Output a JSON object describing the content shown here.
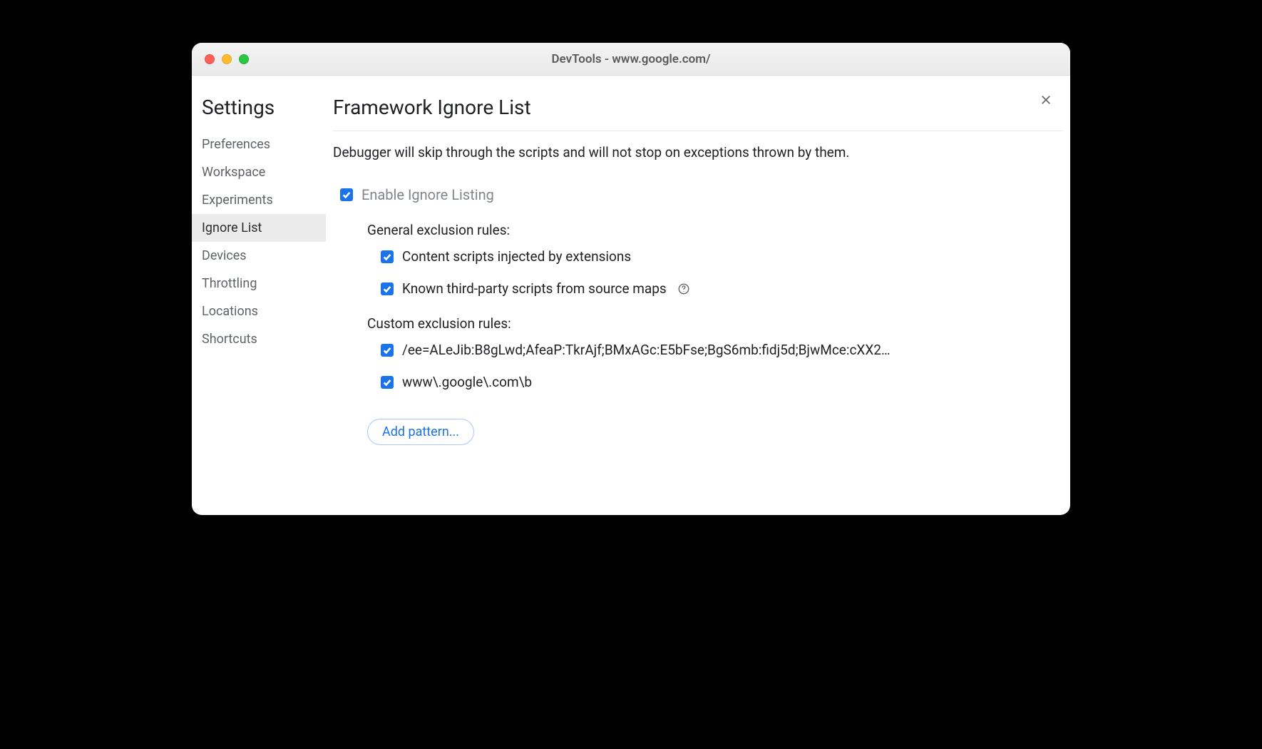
{
  "window": {
    "title": "DevTools - www.google.com/"
  },
  "sidebar": {
    "header": "Settings",
    "items": [
      {
        "label": "Preferences",
        "selected": false
      },
      {
        "label": "Workspace",
        "selected": false
      },
      {
        "label": "Experiments",
        "selected": false
      },
      {
        "label": "Ignore List",
        "selected": true
      },
      {
        "label": "Devices",
        "selected": false
      },
      {
        "label": "Throttling",
        "selected": false
      },
      {
        "label": "Locations",
        "selected": false
      },
      {
        "label": "Shortcuts",
        "selected": false
      }
    ]
  },
  "main": {
    "title": "Framework Ignore List",
    "description": "Debugger will skip through the scripts and will not stop on exceptions thrown by them.",
    "enable_label": "Enable Ignore Listing",
    "general_heading": "General exclusion rules:",
    "general_rules": [
      {
        "label": "Content scripts injected by extensions",
        "checked": true,
        "help": false
      },
      {
        "label": "Known third-party scripts from source maps",
        "checked": true,
        "help": true
      }
    ],
    "custom_heading": "Custom exclusion rules:",
    "custom_rules": [
      {
        "label": "/ee=ALeJib:B8gLwd;AfeaP:TkrAjf;BMxAGc:E5bFse;BgS6mb:fidj5d;BjwMce:cXX2…",
        "checked": true
      },
      {
        "label": "www\\.google\\.com\\b",
        "checked": true
      }
    ],
    "add_button": "Add pattern..."
  }
}
